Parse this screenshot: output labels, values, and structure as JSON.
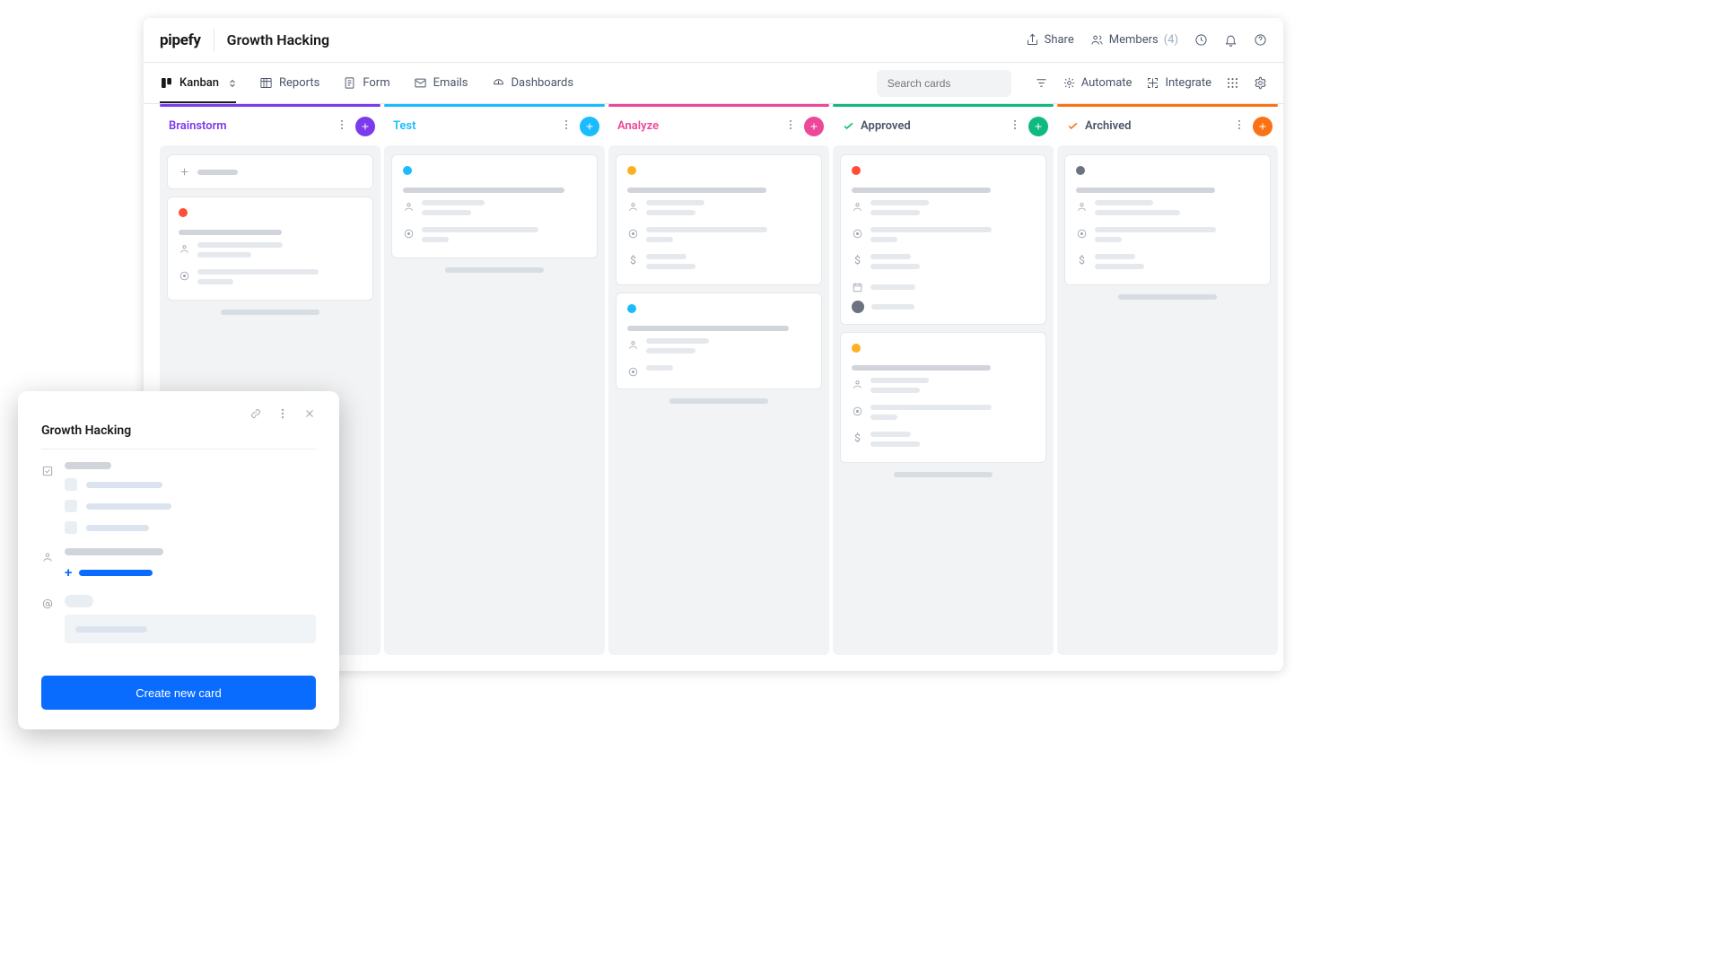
{
  "header": {
    "logo": "pipefy",
    "pipe_title": "Growth Hacking",
    "share": "Share",
    "members": "Members",
    "members_count": "(4)"
  },
  "toolbar": {
    "tabs": {
      "kanban": "Kanban",
      "reports": "Reports",
      "form": "Form",
      "emails": "Emails",
      "dashboards": "Dashboards"
    },
    "search_placeholder": "Search cards",
    "automate": "Automate",
    "integrate": "Integrate"
  },
  "columns": [
    {
      "title": "Brainstorm",
      "color": "#7c3aed",
      "text": "#7c3aed",
      "plus": "#7c3aed",
      "has_check": false
    },
    {
      "title": "Test",
      "color": "#1abcfe",
      "text": "#1abcfe",
      "plus": "#1abcfe",
      "has_check": false
    },
    {
      "title": "Analyze",
      "color": "#ec4899",
      "text": "#ec4899",
      "plus": "#ec4899",
      "has_check": false
    },
    {
      "title": "Approved",
      "color": "#10b981",
      "text": "#4a5568",
      "plus": "#10b981",
      "has_check": true,
      "check_color": "#10b981"
    },
    {
      "title": "Archived",
      "color": "#f97316",
      "text": "#4a5568",
      "plus": "#f97316",
      "has_check": true,
      "check_color": "#f97316"
    }
  ],
  "modal": {
    "title": "Growth Hacking",
    "create_button": "Create new card"
  }
}
